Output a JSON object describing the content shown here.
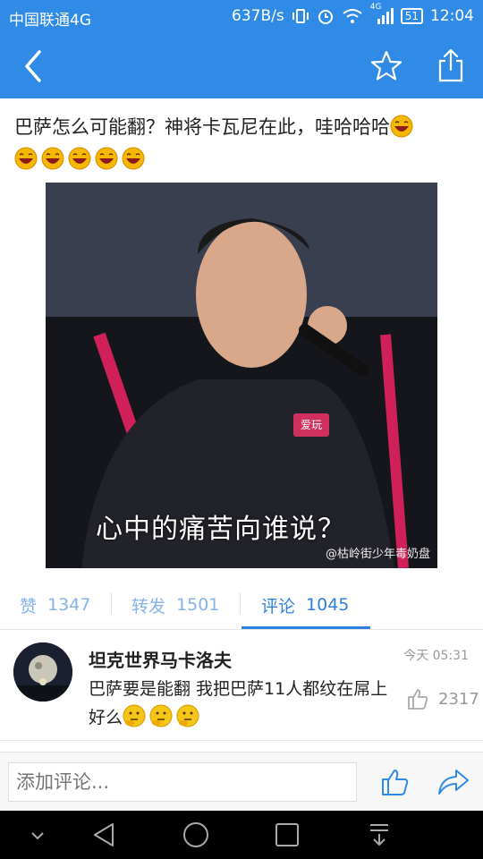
{
  "status_bar": {
    "carrier": "中国联通4G",
    "net_speed": "637B/s",
    "signal_label": "4G",
    "battery": "51",
    "time": "12:04"
  },
  "header": {
    "icons": [
      "back-icon",
      "star-icon",
      "share-icon"
    ],
    "accent_color": "#2f8be6"
  },
  "post": {
    "text": "巴萨怎么可能翻？神将卡瓦尼在此，哇哈哈哈",
    "emoji_count": 6,
    "image": {
      "caption": "心中的痛苦向谁说？",
      "watermark": "@枯岭街少年毒奶盘",
      "badge": "爱玩"
    }
  },
  "tabs": [
    {
      "label": "赞",
      "count": "1347"
    },
    {
      "label": "转发",
      "count": "1501"
    },
    {
      "label": "评论",
      "count": "1045",
      "active": true
    }
  ],
  "comment": {
    "username": "坦克世界马卡洛夫",
    "time": "今天 05:31",
    "body": "巴萨要是能翻 我把巴萨11人都纹在屌上好么",
    "like_count": "2317"
  },
  "input": {
    "placeholder": "添加评论..."
  },
  "nav": [
    "collapse-icon",
    "back-triangle-icon",
    "home-circle-icon",
    "recents-square-icon",
    "notification-pull-icon"
  ]
}
